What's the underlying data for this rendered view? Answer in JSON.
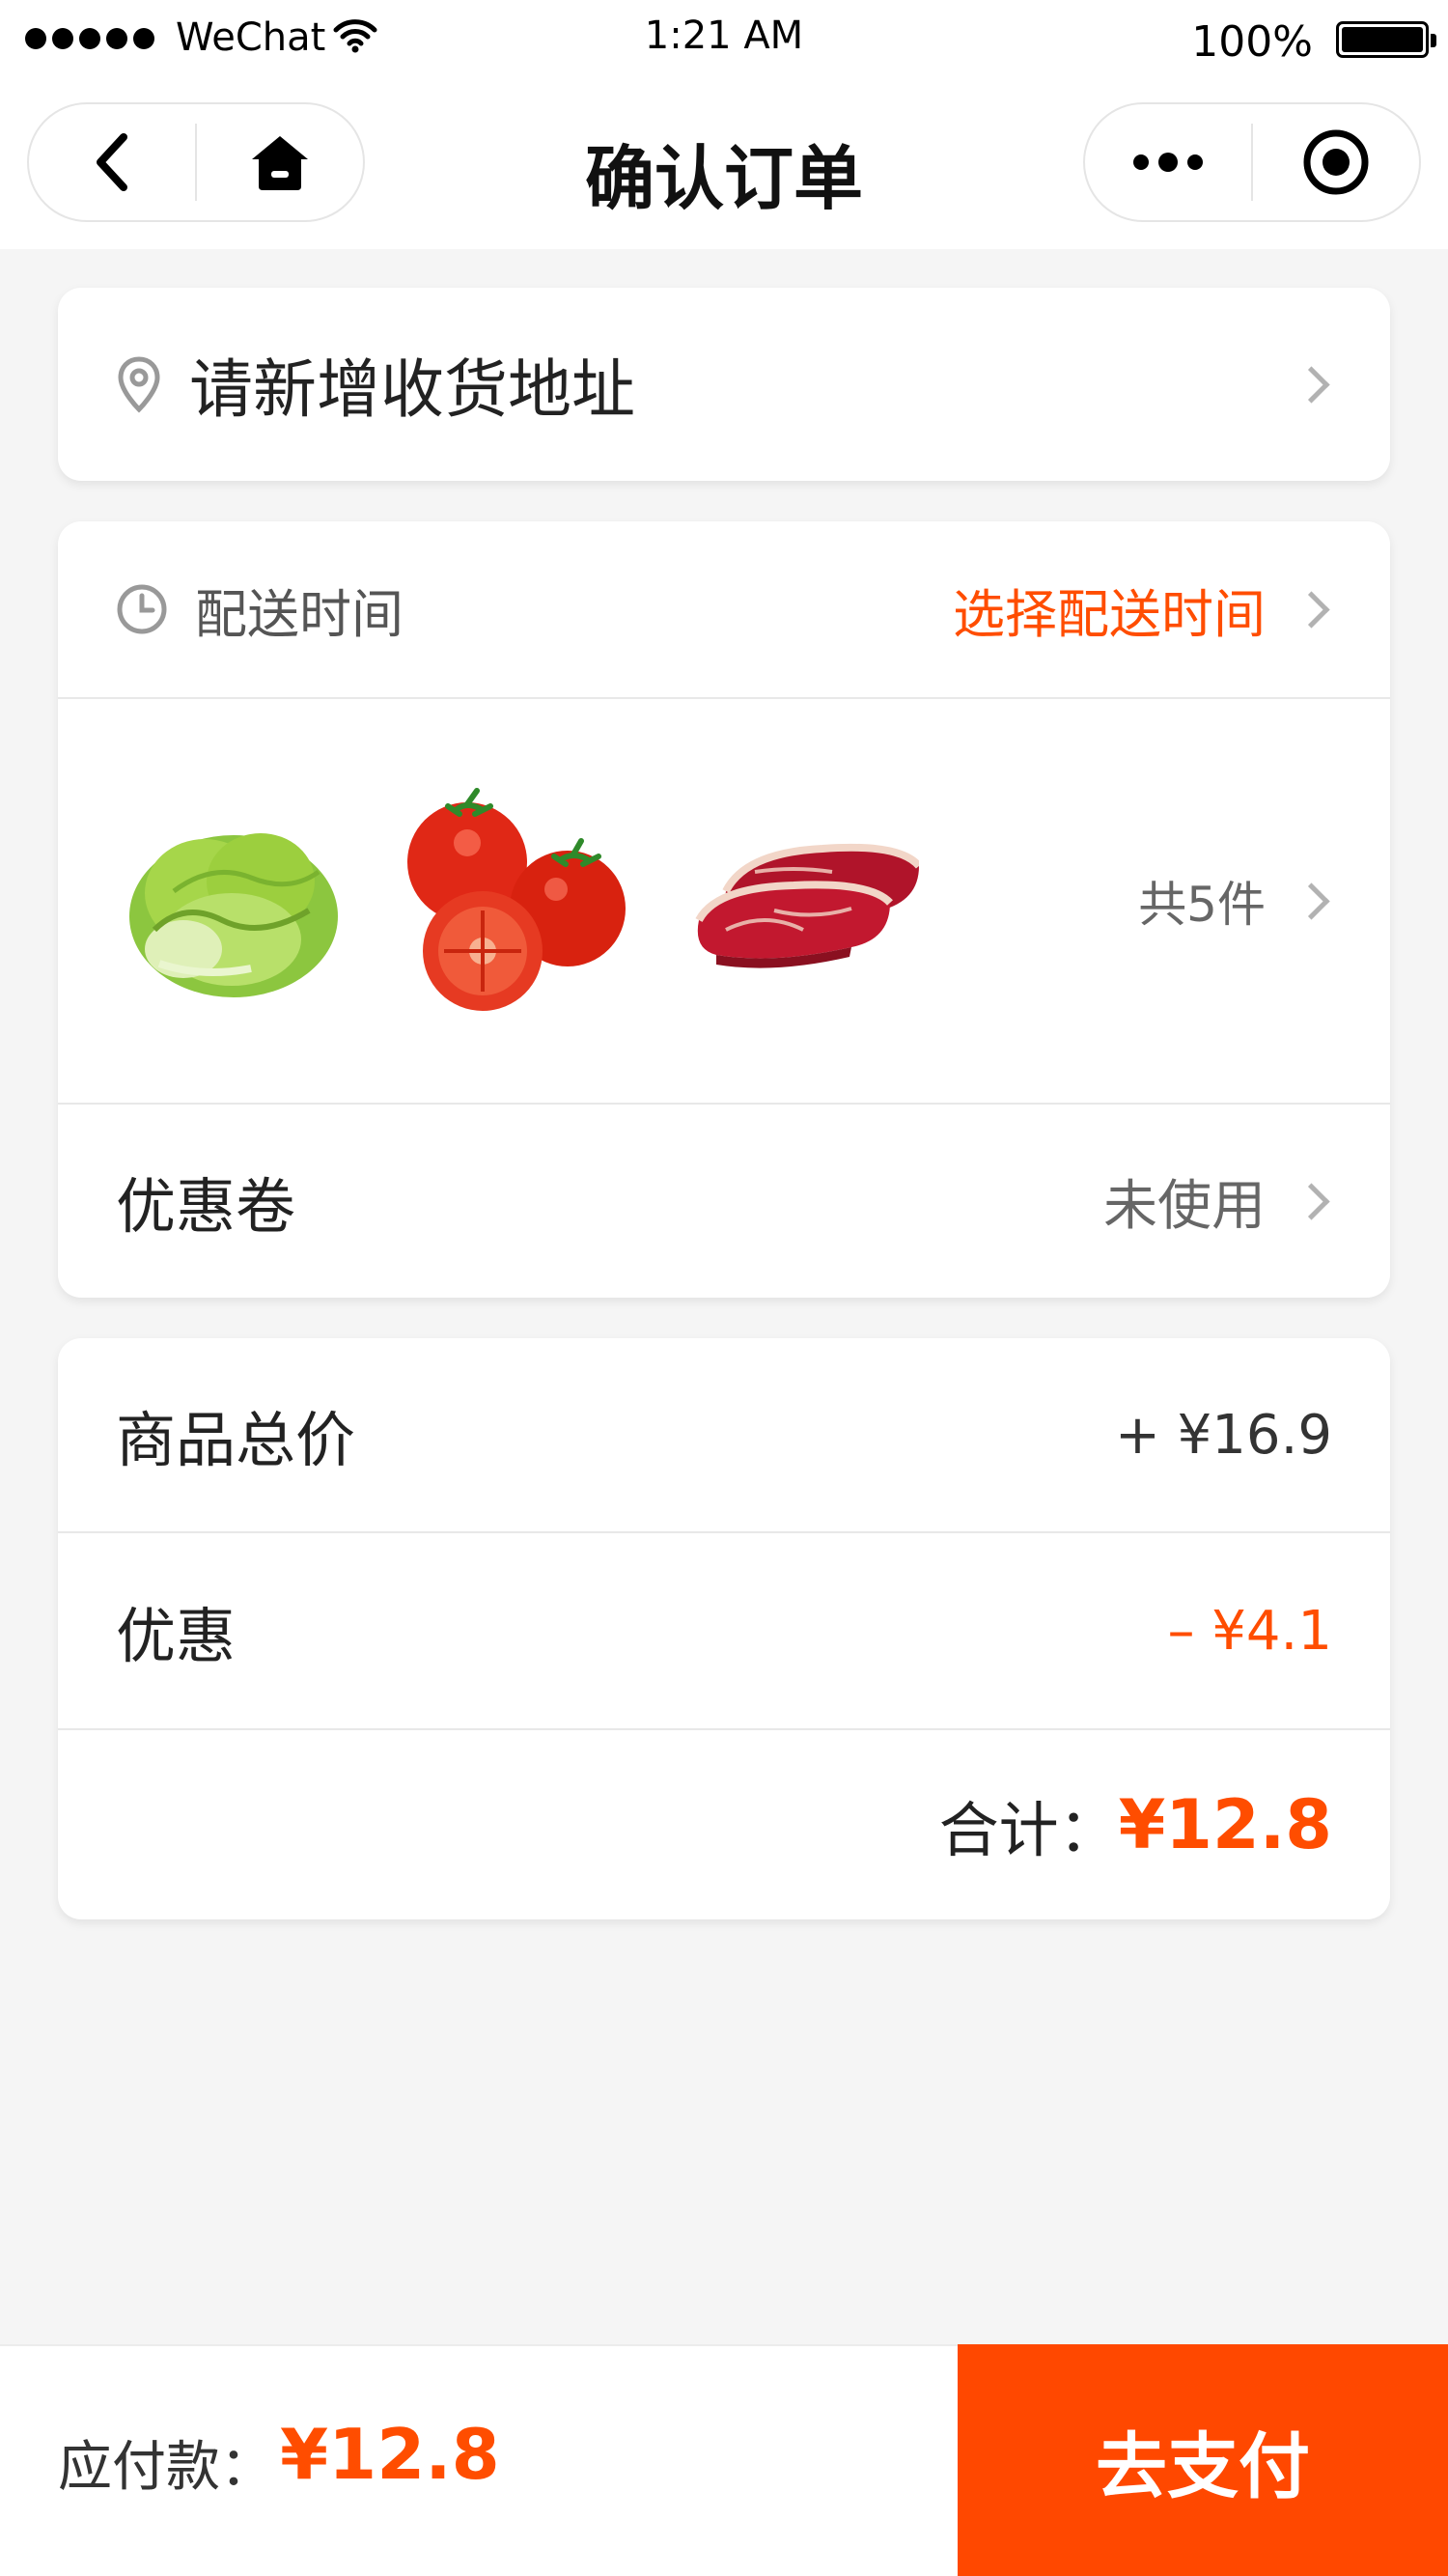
{
  "status_bar": {
    "carrier": "WeChat",
    "time": "1:21 AM",
    "battery": "100%"
  },
  "nav": {
    "title": "确认订单",
    "left_buttons": [
      "back-icon",
      "home-icon"
    ],
    "right_buttons": [
      "more-icon",
      "close-target-icon"
    ]
  },
  "address": {
    "text": "请新增收货地址",
    "icon": "location-pin-icon"
  },
  "delivery": {
    "label": "配送时间",
    "action": "选择配送时间",
    "icon": "clock-icon"
  },
  "products": {
    "items": [
      "lettuce",
      "tomatoes",
      "beef-steak"
    ],
    "count_text": "共5件"
  },
  "coupon": {
    "label": "优惠卷",
    "value": "未使用"
  },
  "price": {
    "subtotal_label": "商品总价",
    "subtotal_value": "+ ¥16.9",
    "discount_label": "优惠",
    "discount_value": "– ¥4.1",
    "total_label": "合计：",
    "total_value": "¥12.8"
  },
  "footer": {
    "pay_label": "应付款：",
    "pay_amount": "¥12.8",
    "pay_button": "去支付"
  },
  "colors": {
    "accent": "#ff4d00",
    "button": "#ff4800",
    "background": "#f5f5f5"
  }
}
